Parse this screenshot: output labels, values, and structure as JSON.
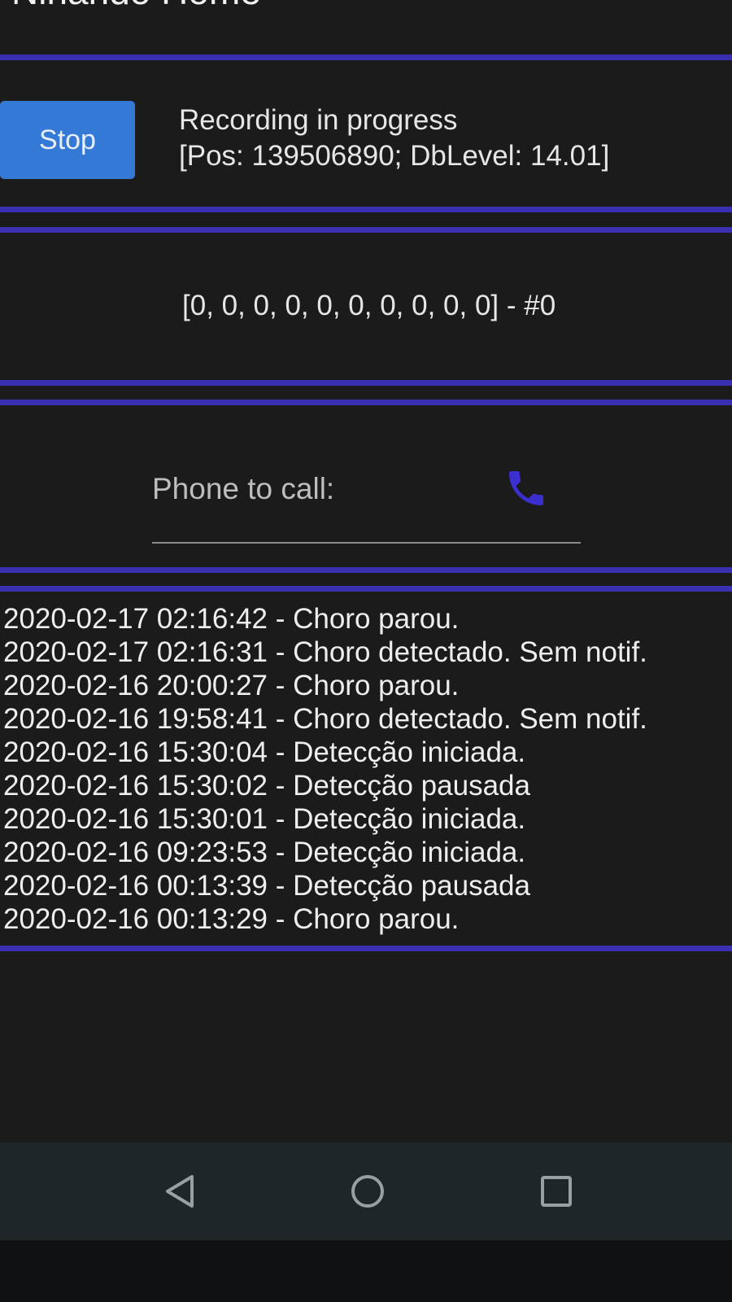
{
  "app": {
    "title": "Ninando Home"
  },
  "recording": {
    "stop_label": "Stop",
    "status_line1": "Recording in progress",
    "status_line2": "[Pos: 139506890;  DbLevel: 14.01]"
  },
  "levels": {
    "text": "[0, 0, 0, 0, 0, 0, 0, 0, 0, 0] - #0"
  },
  "phone": {
    "placeholder": "Phone to call:",
    "value": "",
    "icon": "phone-icon"
  },
  "log": [
    "2020-02-17 02:16:42 - Choro parou.",
    "2020-02-17 02:16:31 - Choro detectado. Sem notif.",
    "2020-02-16 20:00:27 - Choro parou.",
    "2020-02-16 19:58:41 - Choro detectado. Sem notif.",
    "2020-02-16 15:30:04 - Detecção iniciada.",
    "2020-02-16 15:30:02 - Detecção pausada",
    "2020-02-16 15:30:01 - Detecção iniciada.",
    "2020-02-16 09:23:53 - Detecção iniciada.",
    "2020-02-16 00:13:39 - Detecção pausada",
    "2020-02-16 00:13:29 - Choro parou."
  ],
  "navbar": {
    "back_icon": "back-triangle-icon",
    "home_icon": "home-circle-icon",
    "recents_icon": "recents-square-icon"
  },
  "colors": {
    "accent": "#3a2fb0",
    "button": "#3479d6",
    "background": "#1b1b1c"
  }
}
